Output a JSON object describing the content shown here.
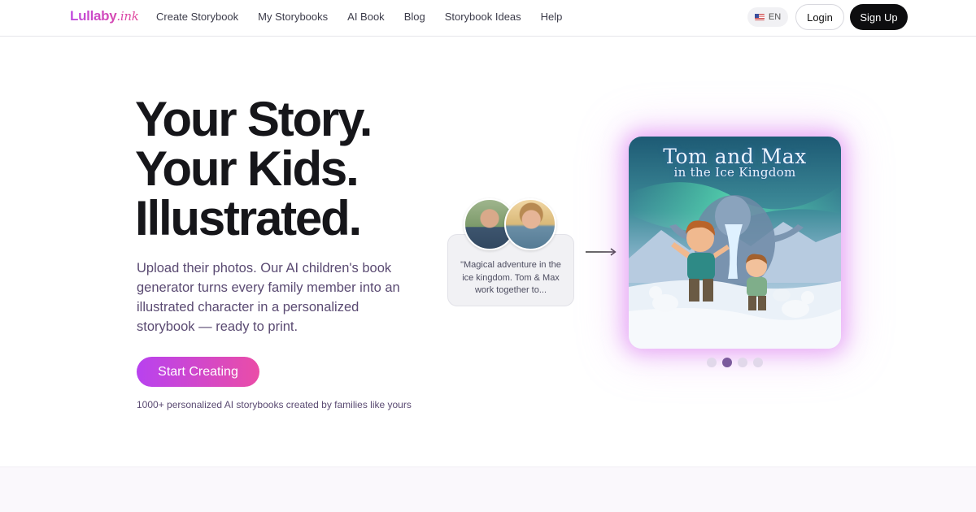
{
  "nav": {
    "logo_main": "Lullaby",
    "logo_suffix": ".ink",
    "links": [
      "Create Storybook",
      "My Storybooks",
      "AI Book",
      "Blog",
      "Storybook Ideas",
      "Help"
    ],
    "language": "EN",
    "login_label": "Login",
    "signup_label": "Sign Up"
  },
  "hero": {
    "headline": [
      "Your Story.",
      "Your Kids.",
      "Illustrated."
    ],
    "subtext": "Upload their photos. Our AI children's book generator turns every family member into an illustrated character in a personalized storybook — ready to print.",
    "cta_label": "Start Creating",
    "social_proof": "1000+ personalized AI storybooks created by families like yours"
  },
  "preview": {
    "prompt_text": "\"Magical adventure in the ice kingdom. Tom & Max work together to...",
    "cover_title_line1": "Tom and Max",
    "cover_title_line2": "in the Ice Kingdom",
    "carousel_total": 4,
    "carousel_active": 2
  },
  "colors": {
    "brand_gradient_start": "#b842ef",
    "brand_gradient_end": "#ea4da7",
    "text_muted": "#5a4a72",
    "dot_active": "#7b5a9c",
    "dot_inactive": "#e1d8ea"
  }
}
